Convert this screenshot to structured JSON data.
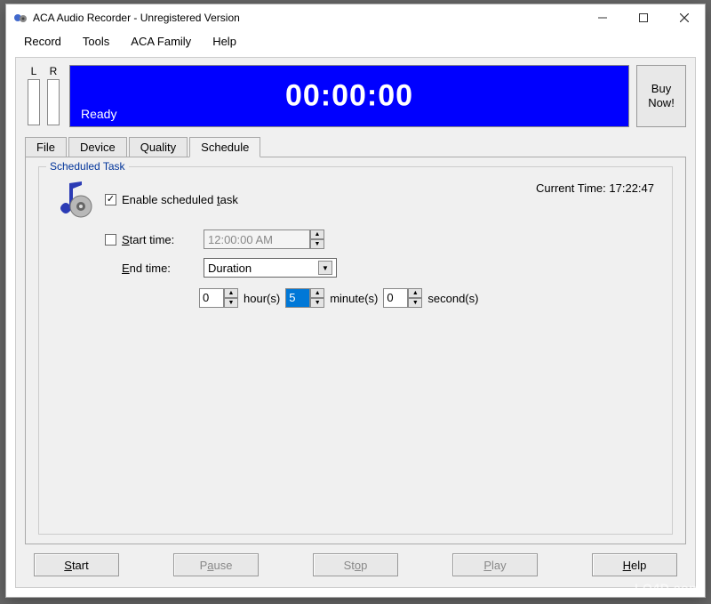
{
  "window": {
    "title": "ACA Audio Recorder - Unregistered Version"
  },
  "menu": {
    "record": "Record",
    "tools": "Tools",
    "aca_family": "ACA Family",
    "help": "Help"
  },
  "meters": {
    "left": "L",
    "right": "R"
  },
  "display": {
    "status": "Ready",
    "timer": "00:00:00"
  },
  "buy_button": "Buy Now!",
  "tabs": {
    "file": "File",
    "device": "Device",
    "quality": "Quality",
    "schedule": "Schedule"
  },
  "schedule": {
    "group_title": "Scheduled Task",
    "enable_label": "Enable scheduled task",
    "enable_checked": true,
    "current_time_label": "Current Time:",
    "current_time_value": "17:22:47",
    "start_time_label": "Start time:",
    "start_time_checked": false,
    "start_time_value": "12:00:00 AM",
    "end_time_label": "End time:",
    "end_time_mode": "Duration",
    "duration": {
      "hours": "0",
      "hours_label": "hour(s)",
      "minutes": "5",
      "minutes_label": "minute(s)",
      "seconds": "0",
      "seconds_label": "second(s)"
    }
  },
  "buttons": {
    "start": "Start",
    "pause": "Pause",
    "stop": "Stop",
    "play": "Play",
    "help": "Help"
  },
  "watermark": "LO4D.com"
}
